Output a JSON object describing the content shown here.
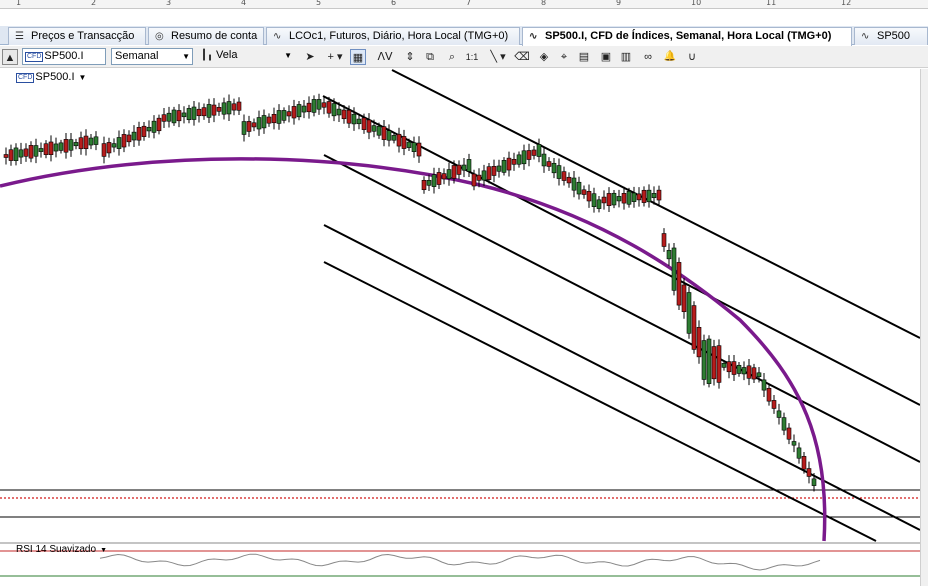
{
  "ruler": {
    "numbers": [
      "1",
      "2",
      "3",
      "4",
      "5",
      "6",
      "7",
      "8",
      "9",
      "10",
      "11",
      "12"
    ]
  },
  "tabs": [
    {
      "label": "Preços e Transacção",
      "icon": "price-list-icon"
    },
    {
      "label": "Resumo de conta",
      "icon": "account-icon"
    },
    {
      "label": "LCOc1, Futuros, Diário, Hora Local (TMG+0)",
      "icon": "chart-line-icon"
    },
    {
      "label": "SP500.I, CFD de Índices, Semanal, Hora Local (TMG+0)",
      "icon": "chart-line-icon",
      "active": true
    },
    {
      "label": "SP500",
      "icon": "chart-line-icon"
    }
  ],
  "toolbar": {
    "symbol": "SP500.I",
    "symbol_badge": "CFD",
    "timeframe": "Semanal",
    "chart_type": "Vela",
    "tool_glyphs": {
      "cursor": "➤",
      "crosshair": "+",
      "grid": "▦",
      "wave": "ᐱᐯ",
      "zoom_in": "⌕",
      "ratio": "1:1",
      "trendline": "╲",
      "eraser": "⌫",
      "fib": "⌖",
      "alert": "🔔",
      "magnet": "∪"
    }
  },
  "chart": {
    "symbol_label": "SP500.I",
    "indicator_label": "RSI 14 Suavizado",
    "colors": {
      "arc": "#7a1a8c",
      "bull": "#2e7d32",
      "bear": "#b71c1c",
      "dotted": "#d21b1b"
    }
  }
}
